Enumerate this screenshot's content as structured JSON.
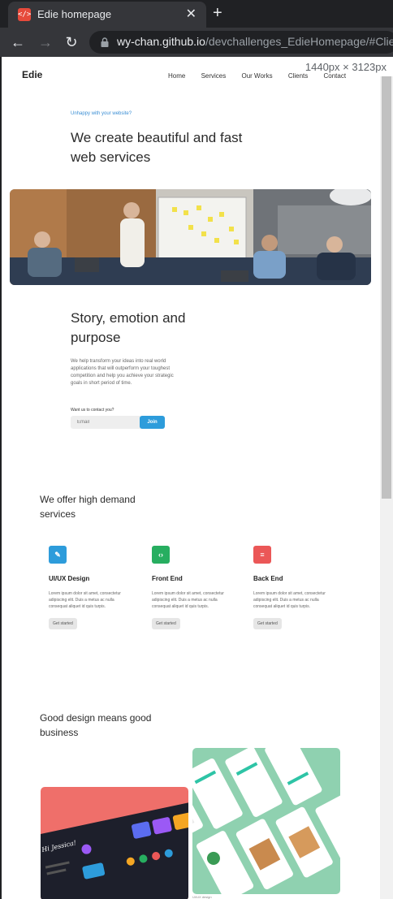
{
  "browser": {
    "tab_title": "Edie homepage",
    "tab_close": "✕",
    "new_tab": "+",
    "url_host": "wy-chan.github.io",
    "url_path": "/devchallenges_EdieHomepage/#Clie",
    "back": "←",
    "forward": "→",
    "reload": "↻",
    "favicon": "</>"
  },
  "devtools_badge": "1440px × 3123px",
  "site": {
    "logo": "Edie",
    "nav": [
      "Home",
      "Services",
      "Our Works",
      "Clients",
      "Contact"
    ],
    "hero": {
      "tagline": "Unhappy with your website?",
      "title": "We create beautiful and fast web services"
    },
    "story": {
      "title": "Story, emotion and purpose",
      "body": "We help transform your ideas into real world applications that will outperform your toughest competition and help you achieve your strategic goals in short period of time.",
      "contact_label": "Want us to contact you?",
      "email_placeholder": "Email",
      "join_label": "Join"
    },
    "services": {
      "title": "We offer high demand services",
      "items": [
        {
          "icon": "pencil-icon",
          "glyph": "✎",
          "color": "#2d9cdb",
          "title": "UI/UX Design",
          "body": "Lorem ipsum dolor sit amet, consectetur adipiscing elit. Duis a metus ac nulla consequat aliquet id quis turpis.",
          "cta": "Get started"
        },
        {
          "icon": "code-icon",
          "glyph": "‹›",
          "color": "#27ae60",
          "title": "Front End",
          "body": "Lorem ipsum dolor sit amet, consectetur adipiscing elit. Duis a metus ac nulla consequat aliquet id quis turpis.",
          "cta": "Get started"
        },
        {
          "icon": "menu-icon",
          "glyph": "≡",
          "color": "#eb5757",
          "title": "Back End",
          "body": "Lorem ipsum dolor sit amet, consectetur adipiscing elit. Duis a metus ac nulla consequat aliquet id quis turpis.",
          "cta": "Get started"
        }
      ]
    },
    "works": {
      "title": "Good design means good business",
      "left_app_heading": "Hi Jessica!",
      "caption": "UI/UX design"
    }
  }
}
